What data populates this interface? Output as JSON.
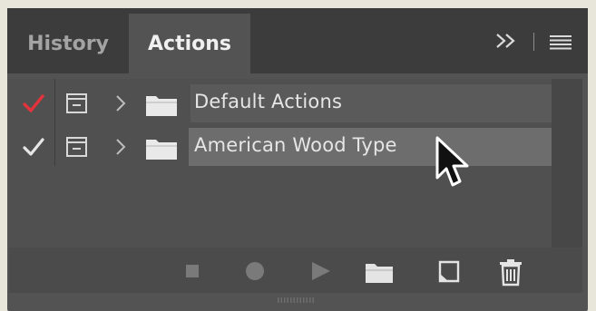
{
  "tabs": [
    {
      "label": "History",
      "active": false
    },
    {
      "label": "Actions",
      "active": true
    }
  ],
  "panel_controls": {
    "collapse_icon": "double-chevron-right-icon",
    "menu_icon": "hamburger-menu-icon"
  },
  "action_sets": [
    {
      "label": "Default Actions",
      "checked": true,
      "check_color": "#e2333d",
      "icons": [
        "checkmark-icon",
        "dialog-toggle-icon",
        "chevron-right-icon",
        "folder-icon"
      ]
    },
    {
      "label": "American Wood Type",
      "checked": true,
      "check_color": "#e6e6e6",
      "icons": [
        "checkmark-icon",
        "dialog-toggle-icon",
        "chevron-right-icon",
        "folder-icon"
      ]
    }
  ],
  "toolbar": {
    "icons": [
      "stop-icon",
      "record-icon",
      "play-icon",
      "new-set-folder-icon",
      "new-action-icon",
      "trash-icon"
    ]
  },
  "colors": {
    "panel_bg": "#535353",
    "tabbar_bg": "#3c3c3c",
    "selected_row": "#6d6d6d",
    "red_check": "#e2333d"
  }
}
